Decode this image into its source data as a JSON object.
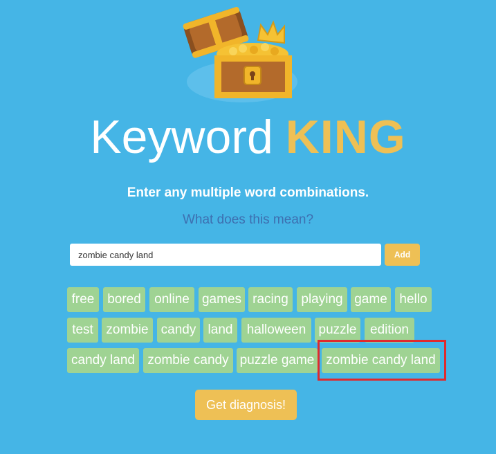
{
  "app": {
    "title_word": "Keyword",
    "title_highlight": "KING",
    "logo_icon": "treasure-chest-icon"
  },
  "colors": {
    "background": "#45b5e6",
    "accent_gold": "#eec055",
    "tag_green": "#9fd393",
    "link_blue": "#3d6fb0",
    "highlight_red": "#e02a2d"
  },
  "instruction": "Enter any multiple word combinations.",
  "help_link": "What does this mean?",
  "keyword_input": {
    "value": "zombie candy land",
    "placeholder": ""
  },
  "add_button": "Add",
  "tags": [
    "free",
    "bored",
    "online",
    "games",
    "racing",
    "playing",
    "game",
    "hello",
    "test",
    "zombie",
    "candy",
    "land",
    "halloween",
    "puzzle",
    "edition",
    "candy land",
    "zombie candy",
    "puzzle game",
    "zombie candy land"
  ],
  "highlighted_tag": "zombie candy land",
  "diagnosis_button": "Get diagnosis!"
}
